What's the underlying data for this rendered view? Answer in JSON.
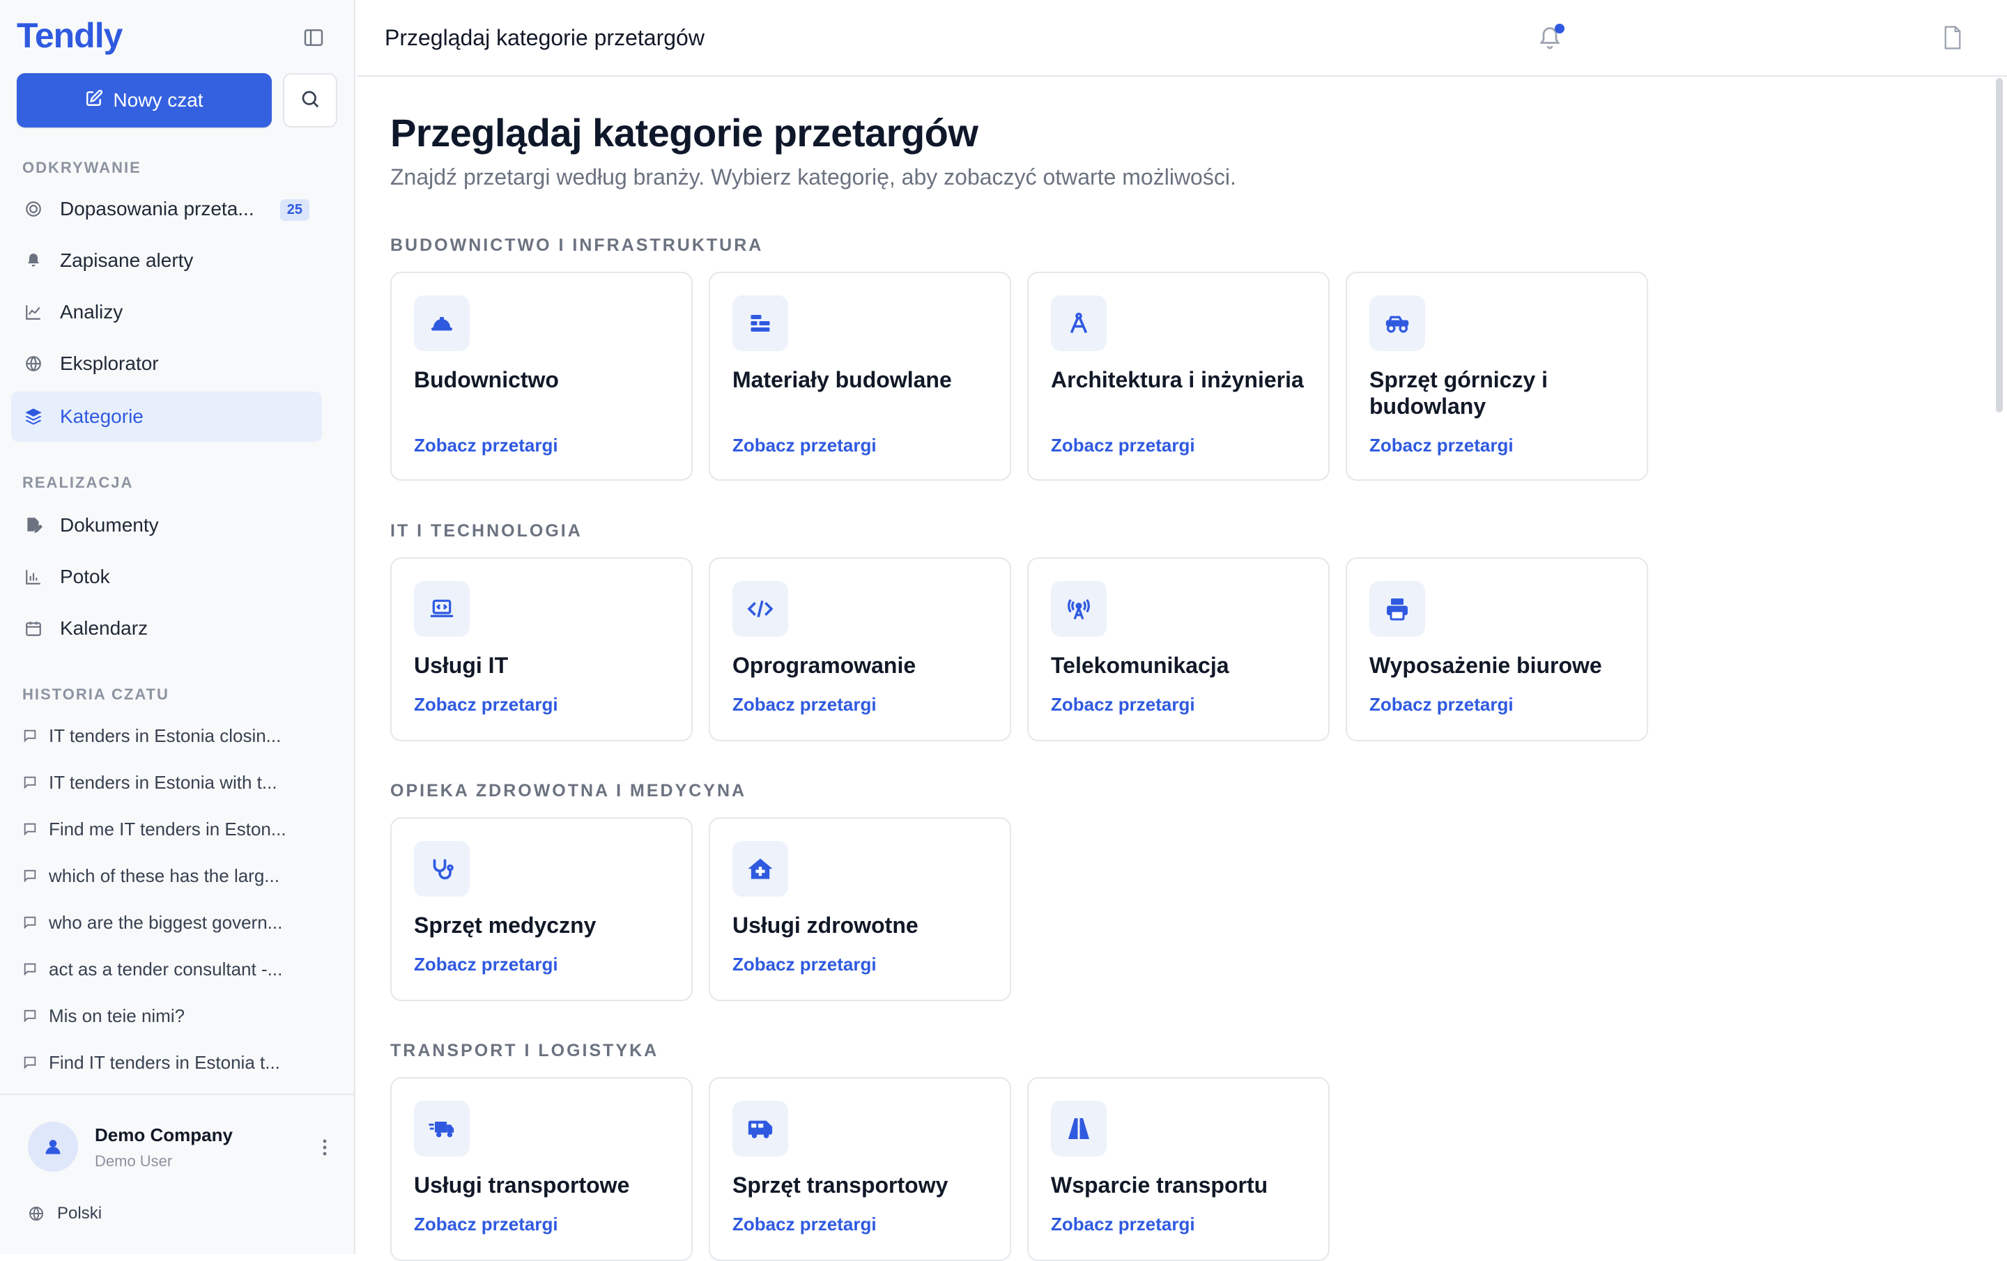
{
  "app": {
    "logo": "Tendly"
  },
  "sidebar": {
    "new_chat_label": "Nowy czat",
    "sections": {
      "discover": "ODKRYWANIE",
      "execution": "REALIZACJA",
      "history": "HISTORIA CZATU"
    },
    "discover_items": [
      {
        "label": "Dopasowania przeta...",
        "icon": "target-icon",
        "badge": "25"
      },
      {
        "label": "Zapisane alerty",
        "icon": "bell-icon"
      },
      {
        "label": "Analizy",
        "icon": "chart-line-icon"
      },
      {
        "label": "Eksplorator",
        "icon": "globe-icon"
      },
      {
        "label": "Kategorie",
        "icon": "layers-icon",
        "active": true
      }
    ],
    "execution_items": [
      {
        "label": "Dokumenty",
        "icon": "file-edit-icon"
      },
      {
        "label": "Potok",
        "icon": "bar-chart-icon"
      },
      {
        "label": "Kalendarz",
        "icon": "calendar-icon"
      }
    ],
    "history_items": [
      "IT tenders in Estonia closin...",
      "IT tenders in Estonia with t...",
      "Find me IT tenders in Eston...",
      "which of these has the larg...",
      "who are the biggest govern...",
      "act as a tender consultant -...",
      "Mis on teie nimi?",
      "Find IT tenders in Estonia t..."
    ],
    "footer": {
      "company": "Demo Company",
      "user": "Demo User",
      "language": "Polski"
    }
  },
  "header": {
    "title": "Przeglądaj kategorie przetargów"
  },
  "main": {
    "title": "Przeglądaj kategorie przetargów",
    "subtitle": "Znajdź przetargi według branży. Wybierz kategorię, aby zobaczyć otwarte możliwości.",
    "link_label": "Zobacz przetargi",
    "categories": [
      {
        "label": "BUDOWNICTWO I INFRASTRUKTURA",
        "cards": [
          {
            "name": "Budownictwo",
            "icon": "hard-hat-icon"
          },
          {
            "name": "Materiały budowlane",
            "icon": "materials-icon"
          },
          {
            "name": "Architektura i inżynieria",
            "icon": "compass-icon"
          },
          {
            "name": "Sprzęt górniczy i budowlany",
            "icon": "truck-monster-icon"
          }
        ]
      },
      {
        "label": "IT I TECHNOLOGIA",
        "cards": [
          {
            "name": "Usługi IT",
            "icon": "laptop-code-icon"
          },
          {
            "name": "Oprogramowanie",
            "icon": "code-icon"
          },
          {
            "name": "Telekomunikacja",
            "icon": "tower-broadcast-icon"
          },
          {
            "name": "Wyposażenie biurowe",
            "icon": "printer-icon"
          }
        ]
      },
      {
        "label": "OPIEKA ZDROWOTNA I MEDYCYNA",
        "cards": [
          {
            "name": "Sprzęt medyczny",
            "icon": "stethoscope-icon"
          },
          {
            "name": "Usługi zdrowotne",
            "icon": "house-medical-icon"
          }
        ]
      },
      {
        "label": "TRANSPORT I LOGISTYKA",
        "cards": [
          {
            "name": "Usługi transportowe",
            "icon": "truck-fast-icon"
          },
          {
            "name": "Sprzęt transportowy",
            "icon": "van-icon"
          },
          {
            "name": "Wsparcie transportu",
            "icon": "road-icon"
          }
        ]
      }
    ]
  },
  "colors": {
    "accent": "#2f5ae0",
    "button": "#3461e0",
    "icon_bg": "#eef2fb",
    "sidebar_bg": "#f8f9fa"
  }
}
